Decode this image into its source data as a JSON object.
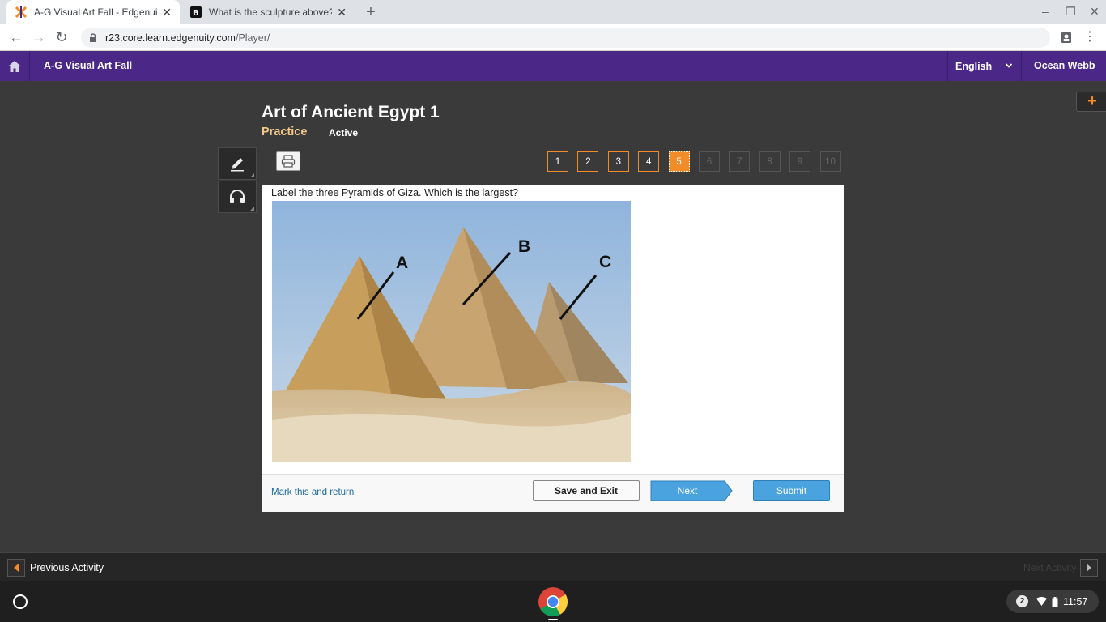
{
  "browser": {
    "tabs": [
      {
        "title": "A-G Visual Art Fall - Edgenuity.com",
        "active": true
      },
      {
        "title": "What is the sculpture above? Des",
        "active": false
      }
    ],
    "url_host": "r23.core.learn.edgenuity.com",
    "url_path": "/Player/"
  },
  "header": {
    "course_title": "A-G Visual Art Fall",
    "language": "English",
    "user_name": "Ocean Webb"
  },
  "lesson": {
    "title": "Art of Ancient Egypt 1",
    "type": "Practice",
    "status": "Active"
  },
  "question_nav": {
    "numbers": [
      "1",
      "2",
      "3",
      "4",
      "5",
      "6",
      "7",
      "8",
      "9",
      "10"
    ],
    "current": "5"
  },
  "question": {
    "text": "Label the three Pyramids of Giza. Which is the largest?",
    "image_labels": [
      "A",
      "B",
      "C"
    ]
  },
  "footer": {
    "mark_link": "Mark this and return",
    "save_exit": "Save and Exit",
    "next": "Next",
    "submit": "Submit"
  },
  "activity_bar": {
    "previous": "Previous Activity",
    "next": "Next Activity"
  },
  "shelf": {
    "notification_count": "2",
    "time": "11:57"
  },
  "colors": {
    "header_purple": "#4b2888",
    "accent_orange": "#f28c28",
    "button_blue": "#4aa3df",
    "practice_gold": "#f2c98a"
  }
}
